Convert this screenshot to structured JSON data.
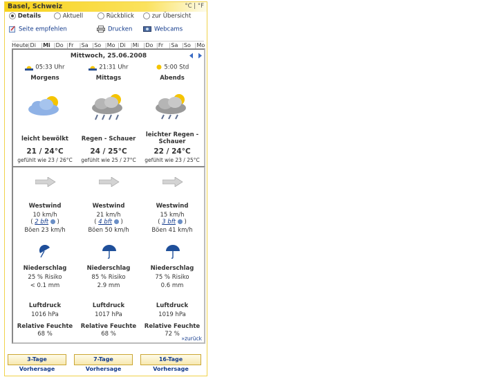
{
  "header": {
    "location": "Basel, Schweiz",
    "units": "°C | °F"
  },
  "options": [
    "Details",
    "Aktuell",
    "Rückblick",
    "zur Übersicht"
  ],
  "links": [
    "Seite empfehlen",
    "Drucken",
    "Webcams"
  ],
  "days": [
    "Heute",
    "Di",
    "Mi",
    "Do",
    "Fr",
    "Sa",
    "So",
    "Mo",
    "Di",
    "Mi",
    "Do",
    "Fr",
    "Sa",
    "So",
    "Mo"
  ],
  "date": "Mittwoch, 25.06.2008",
  "sun": {
    "sunrise": "05:33 Uhr",
    "sunset": "21:31 Uhr",
    "duration": "5:00 Std"
  },
  "periods": [
    {
      "name": "Morgens",
      "desc": "leicht bewölkt",
      "temp": "21 / 24°C",
      "feels": "gefühlt wie 23 / 26°C",
      "wind": "Westwind",
      "speed": "10 km/h",
      "bft": "2 bft",
      "gusts": "Böen 23 km/h",
      "precip_label": "Niederschlag",
      "risk": "25 % Risiko",
      "amount": "< 0.1 mm",
      "pressure_label": "Luftdruck",
      "pressure": "1016 hPa",
      "humidity_label": "Relative Feuchte",
      "humidity": "68 %"
    },
    {
      "name": "Mittags",
      "desc": "Regen - Schauer",
      "temp": "24 / 25°C",
      "feels": "gefühlt wie 25 / 27°C",
      "wind": "Westwind",
      "speed": "21 km/h",
      "bft": "4 bft",
      "gusts": "Böen 50 km/h",
      "precip_label": "Niederschlag",
      "risk": "85 % Risiko",
      "amount": "2.9 mm",
      "pressure_label": "Luftdruck",
      "pressure": "1017 hPa",
      "humidity_label": "Relative Feuchte",
      "humidity": "68 %"
    },
    {
      "name": "Abends",
      "desc": "leichter Regen - Schauer",
      "temp": "22 / 24°C",
      "feels": "gefühlt wie 23 / 25°C",
      "wind": "Westwind",
      "speed": "15 km/h",
      "bft": "3 bft",
      "gusts": "Böen 41 km/h",
      "precip_label": "Niederschlag",
      "risk": "75 % Risiko",
      "amount": "0.6 mm",
      "pressure_label": "Luftdruck",
      "pressure": "1019 hPa",
      "humidity_label": "Relative Feuchte",
      "humidity": "72 %"
    }
  ],
  "back_link": "»zurück",
  "buttons": [
    "3-Tage Vorhersage",
    "7-Tage Vorhersage",
    "16-Tage Vorhersage"
  ]
}
